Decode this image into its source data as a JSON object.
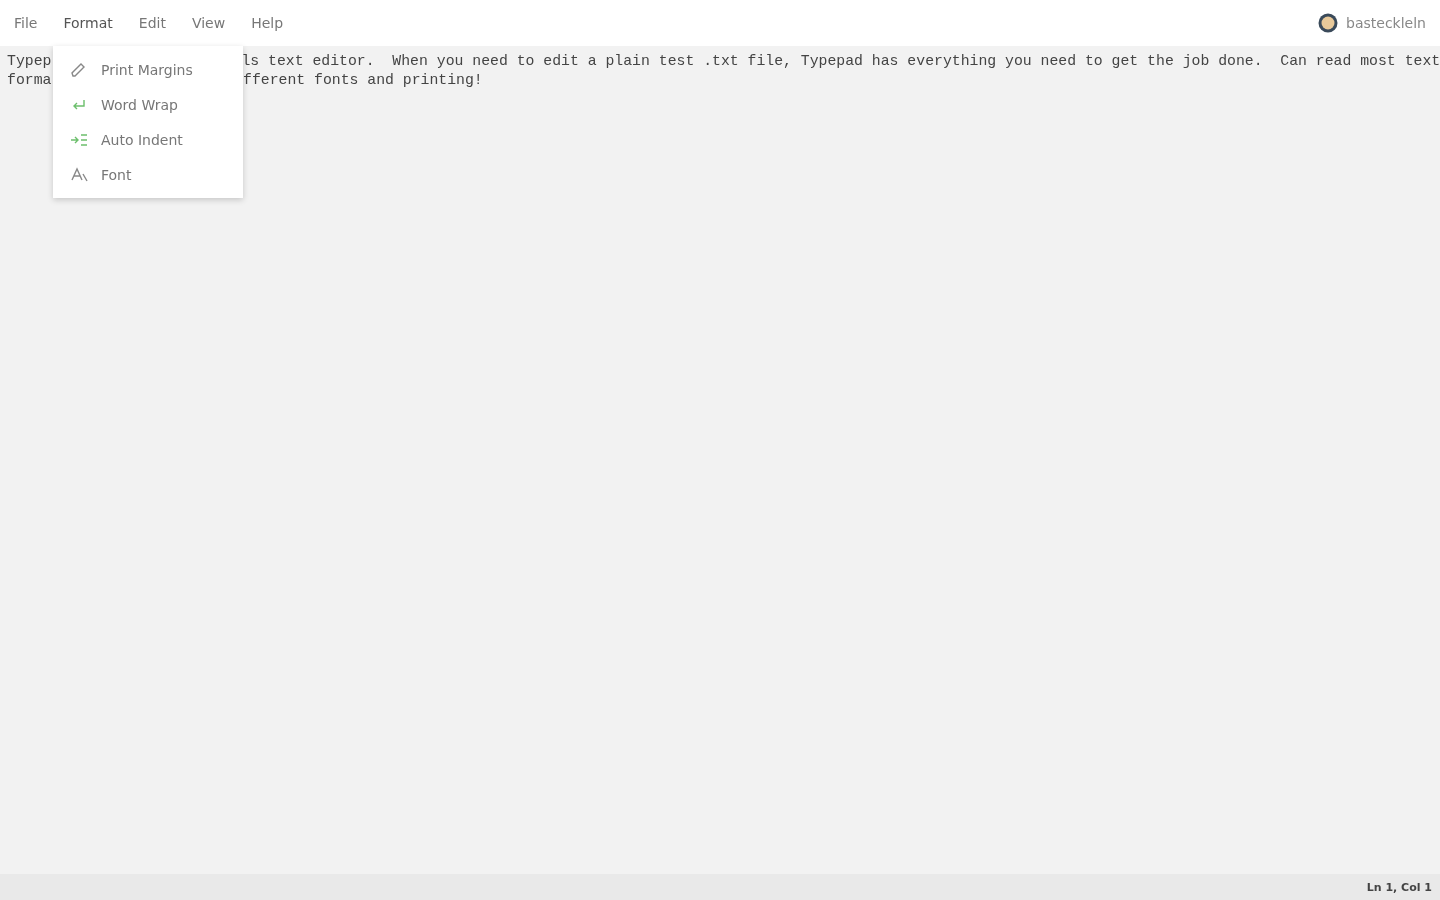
{
  "menubar": {
    "items": [
      {
        "label": "File",
        "selected": false
      },
      {
        "label": "Format",
        "selected": true
      },
      {
        "label": "Edit",
        "selected": false
      },
      {
        "label": "View",
        "selected": false
      },
      {
        "label": "Help",
        "selected": false
      }
    ]
  },
  "user": {
    "name": "basteckleln"
  },
  "editor": {
    "lines": [
      {
        "left": "Typep",
        "right": "ls text editor.  When you need to edit a plain test .txt file, Typepad has everything you need to get the job done.  Can read most text"
      },
      {
        "left": "forma",
        "right": "fferent fonts and printing!"
      }
    ]
  },
  "format_menu": {
    "items": [
      {
        "kind": "margins",
        "label": "Print Margins",
        "on": false
      },
      {
        "kind": "wrap",
        "label": "Word Wrap",
        "on": true
      },
      {
        "kind": "indent",
        "label": "Auto Indent",
        "on": true
      },
      {
        "kind": "font",
        "label": "Font",
        "on": false
      }
    ]
  },
  "status_bar": {
    "position": "Ln 1, Col 1"
  }
}
